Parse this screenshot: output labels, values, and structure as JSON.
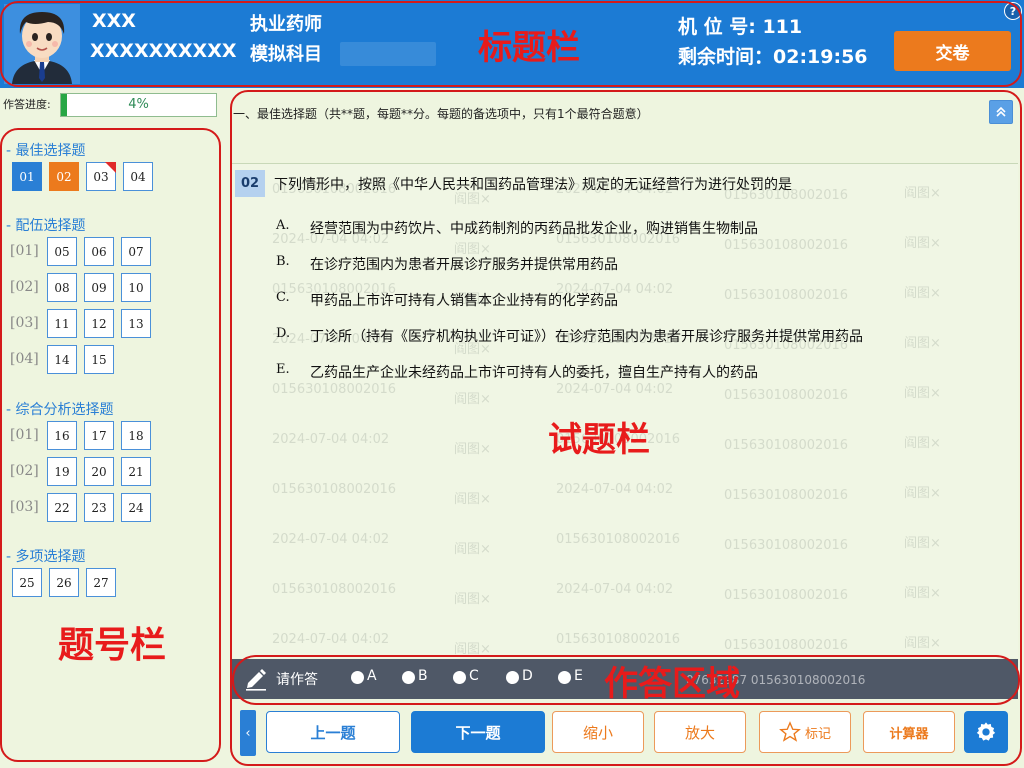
{
  "header": {
    "user_name": "XXX",
    "user_id": "XXXXXXXXXX",
    "cert_name": "执业药师",
    "subject": "模拟科目",
    "seat": "机 位 号: 111",
    "remaining": "剩余时间：02:19:56",
    "submit_label": "交卷",
    "help": "?",
    "brand_color": "#1c7bd4"
  },
  "annotations": {
    "title_bar": "标题栏",
    "question_area": "试题栏",
    "number_bar": "题号栏",
    "answer_area": "作答区域"
  },
  "progress": {
    "label": "作答进度:",
    "value": 0.04,
    "text": "4%"
  },
  "sections": [
    {
      "title": "- 最佳选择题",
      "groups": [
        {
          "label": "",
          "items": [
            {
              "n": "01",
              "state": "current"
            },
            {
              "n": "02",
              "state": "answered"
            },
            {
              "n": "03",
              "state": "marked"
            },
            {
              "n": "04",
              "state": "none"
            }
          ]
        }
      ]
    },
    {
      "title": "- 配伍选择题",
      "groups": [
        {
          "label": "[01]",
          "items": [
            {
              "n": "05"
            },
            {
              "n": "06"
            },
            {
              "n": "07"
            }
          ]
        },
        {
          "label": "[02]",
          "items": [
            {
              "n": "08"
            },
            {
              "n": "09"
            },
            {
              "n": "10"
            }
          ]
        },
        {
          "label": "[03]",
          "items": [
            {
              "n": "11"
            },
            {
              "n": "12"
            },
            {
              "n": "13"
            }
          ]
        },
        {
          "label": "[04]",
          "items": [
            {
              "n": "14"
            },
            {
              "n": "15"
            }
          ]
        }
      ]
    },
    {
      "title": "- 综合分析选择题",
      "groups": [
        {
          "label": "[01]",
          "items": [
            {
              "n": "16"
            },
            {
              "n": "17"
            },
            {
              "n": "18"
            }
          ]
        },
        {
          "label": "[02]",
          "items": [
            {
              "n": "19"
            },
            {
              "n": "20"
            },
            {
              "n": "21"
            }
          ]
        },
        {
          "label": "[03]",
          "items": [
            {
              "n": "22"
            },
            {
              "n": "23"
            },
            {
              "n": "24"
            }
          ]
        }
      ]
    },
    {
      "title": "- 多项选择题",
      "groups": [
        {
          "label": "",
          "items": [
            {
              "n": "25"
            },
            {
              "n": "26"
            },
            {
              "n": "27"
            }
          ]
        }
      ]
    }
  ],
  "question": {
    "instruction": "一、最佳选择题（共**题，每题**分。每题的备选项中，只有1个最符合题意）",
    "number": "02",
    "stem": "下列情形中，按照《中华人民共和国药品管理法》规定的无证经营行为进行处罚的是",
    "options": [
      {
        "letter": "A.",
        "text": "经营范围为中药饮片、中成药制剂的丙药品批发企业，购进销售生物制品"
      },
      {
        "letter": "B.",
        "text": "在诊疗范围内为患者开展诊疗服务并提供常用药品"
      },
      {
        "letter": "C.",
        "text": "甲药品上市许可持有人销售本企业持有的化学药品"
      },
      {
        "letter": "D.",
        "text": "丁诊所（持有《医疗机构执业许可证》）在诊疗范围内为患者开展诊疗服务并提供常用药品"
      },
      {
        "letter": "E.",
        "text": "乙药品生产企业未经药品上市许可持有人的委托，擅自生产持有人的药品"
      }
    ]
  },
  "watermark": {
    "code": "015630108002016",
    "date": "2024-07-04 04:02",
    "name": "阎图×"
  },
  "answer": {
    "prompt": "请作答",
    "choices": [
      "A",
      "B",
      "C",
      "D",
      "E"
    ],
    "watermark": "07632987 015630108002016"
  },
  "nav": {
    "collapse": "‹",
    "prev": "上一题",
    "next": "下一题",
    "shrink": "缩小",
    "enlarge": "放大",
    "mark": "标记",
    "calculator": "计算器"
  }
}
